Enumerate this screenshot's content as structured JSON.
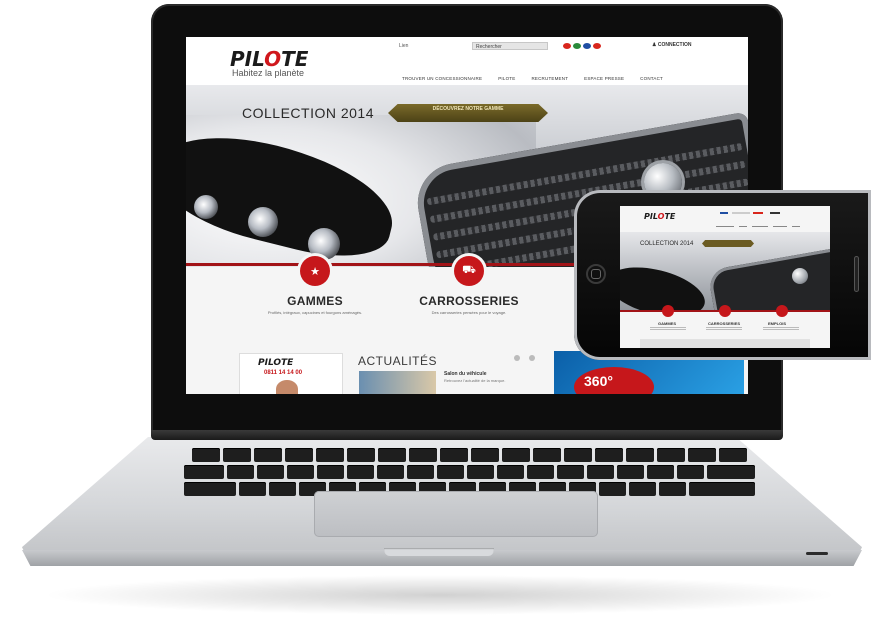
{
  "website": {
    "logo_main": "PIL",
    "logo_accent": "O",
    "logo_end": "TE",
    "tagline": "Habitez la planète",
    "lang_label": "Lien",
    "search_placeholder": "Rechercher",
    "account_label": "CONNECTION",
    "nav": [
      "TROUVER UN CONCESSIONNAIRE",
      "PILOTE",
      "RECRUTEMENT",
      "ESPACE PRESSE",
      "CONTACT"
    ],
    "hero_title": "COLLECTION 2014",
    "promo_text": "DÉCOUVREZ NOTRE GAMME",
    "categories": [
      {
        "title": "GAMMES",
        "desc": "Profilés, intégraux, capucines et fourgons aménagés."
      },
      {
        "title": "CARROSSERIES",
        "desc": "Des carrosseries pensées pour le voyage."
      }
    ],
    "ad_logo": "PILOTE",
    "ad_phone": "0811 14 14 00",
    "news_title": "ACTUALITÉS",
    "news_head": "Salon du véhicule",
    "news_body": "Retrouvez l'actualité de la marque.",
    "banner_text": "360°"
  },
  "phone_site": {
    "logo_main": "PIL",
    "logo_accent": "O",
    "logo_end": "TE",
    "hero_title": "COLLECTION 2014",
    "categories": [
      "GAMMES",
      "CARROSSERIES",
      "EMPLOIS"
    ]
  },
  "colors": {
    "brand_red": "#c6171b",
    "promo_gold": "#6b5b22",
    "laptop_bezel": "#0d0d0d"
  }
}
